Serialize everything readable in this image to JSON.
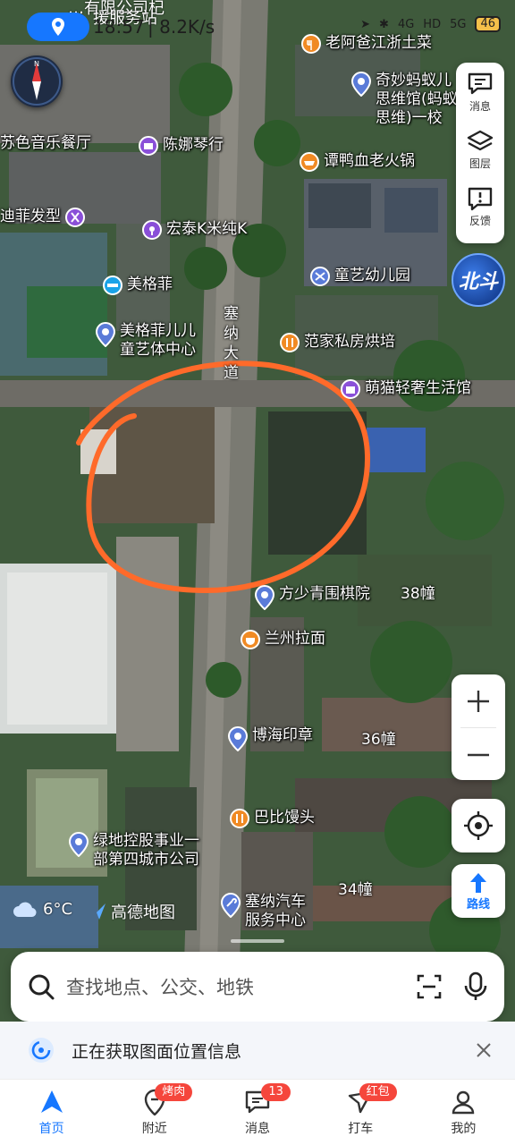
{
  "status_bar": {
    "time": "18:57",
    "net_speed": "8.2K/s",
    "battery": "46",
    "signal_labels": [
      "4G",
      "HD",
      "5G"
    ]
  },
  "notification_top": {
    "line1": "…有限公司杞",
    "line2": "援服务站"
  },
  "tools": [
    {
      "label": "消息",
      "icon": "message-icon"
    },
    {
      "label": "图层",
      "icon": "layers-icon"
    },
    {
      "label": "反馈",
      "icon": "feedback-icon"
    }
  ],
  "beidou_label": "北斗",
  "route_label": "路线",
  "road_name": "塞纳大道",
  "pois": [
    {
      "name": "老阿爸江浙土菜",
      "icon": "restaurant-icon",
      "color": "#f08a24"
    },
    {
      "name": "奇妙蚂蚁儿思维馆(蚂蚁思维)一校",
      "line1": "奇妙蚂蚁儿",
      "line2": "思维馆(蚂蚁",
      "line3": "思维)一校",
      "icon": "location-pin-icon",
      "color": "#5a7bd8"
    },
    {
      "name": "苏色音乐餐厅",
      "icon": "none",
      "color": "#ffffff"
    },
    {
      "name": "陈娜琴行",
      "icon": "music-icon",
      "color": "#8a4fd8"
    },
    {
      "name": "谭鸭血老火锅",
      "icon": "restaurant-icon",
      "color": "#f08a24"
    },
    {
      "name": "迪菲发型",
      "icon": "scissors-icon",
      "color": "#8a4fd8"
    },
    {
      "name": "宏泰K米纯K",
      "icon": "ktv-icon",
      "color": "#8a4fd8"
    },
    {
      "name": "童艺幼儿园",
      "icon": "school-icon",
      "color": "#5a7bd8"
    },
    {
      "name": "美格菲",
      "icon": "gym-icon",
      "color": "#1aa3e8"
    },
    {
      "name": "美格菲儿儿童艺体中心",
      "line1": "美格菲儿儿",
      "line2": "童艺体中心",
      "icon": "location-pin-icon",
      "color": "#5a7bd8"
    },
    {
      "name": "范家私房烘培",
      "icon": "restaurant-icon",
      "color": "#f08a24"
    },
    {
      "name": "萌猫轻奢生活馆",
      "icon": "shop-icon",
      "color": "#8a4fd8"
    },
    {
      "name": "方少青围棋院",
      "icon": "location-pin-icon",
      "color": "#5a7bd8"
    },
    {
      "name": "兰州拉面",
      "icon": "restaurant-icon",
      "color": "#f08a24"
    },
    {
      "name": "博海印章",
      "icon": "location-pin-icon",
      "color": "#5a7bd8"
    },
    {
      "name": "巴比馒头",
      "icon": "restaurant-icon",
      "color": "#f08a24"
    },
    {
      "name": "绿地控股事业一部第四城市公司",
      "line1": "绿地控股事业一",
      "line2": "部第四城市公司",
      "icon": "location-pin-icon",
      "color": "#5a7bd8"
    },
    {
      "name": "塞纳汽车服务中心",
      "line1": "塞纳汽车",
      "line2": "服务中心",
      "icon": "wrench-icon",
      "color": "#5a7bd8"
    }
  ],
  "buildings": [
    "38幢",
    "36幢",
    "34幢"
  ],
  "weather": {
    "temp": "6°C",
    "icon": "cloud-icon"
  },
  "brand": "高德地图",
  "search": {
    "placeholder": "查找地点、公交、地铁"
  },
  "info_bar": {
    "message": "正在获取图面位置信息"
  },
  "tabs": [
    {
      "label": "首页",
      "icon": "home-navigation-icon",
      "active": true,
      "badge": ""
    },
    {
      "label": "附近",
      "icon": "nearby-icon",
      "active": false,
      "badge": "烤肉"
    },
    {
      "label": "消息",
      "icon": "message-icon",
      "active": false,
      "badge": "13"
    },
    {
      "label": "打车",
      "icon": "taxi-icon",
      "active": false,
      "badge": "红包"
    },
    {
      "label": "我的",
      "icon": "profile-icon",
      "active": false,
      "badge": ""
    }
  ],
  "colors": {
    "accent": "#1677ff",
    "badge": "#f5463c",
    "annotation_circle": "#ff6a2a"
  }
}
